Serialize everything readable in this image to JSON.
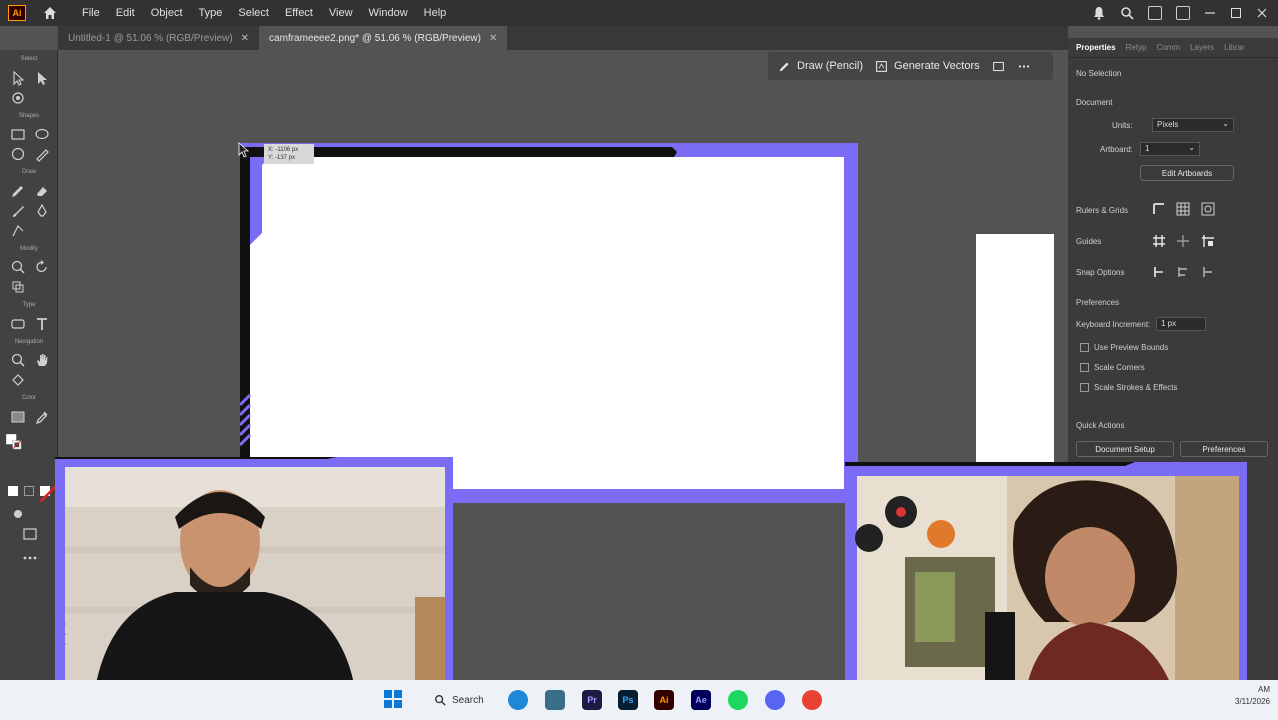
{
  "app": {
    "logo_text": "Ai",
    "menu": [
      "File",
      "Edit",
      "Object",
      "Type",
      "Select",
      "Effect",
      "View",
      "Window",
      "Help"
    ]
  },
  "tabs": [
    {
      "label": "Untitled-1 @ 51.06 % (RGB/Preview)",
      "active": false
    },
    {
      "label": "camframeeee2.png* @ 51.06 % (RGB/Preview)",
      "active": true
    }
  ],
  "toolbar": {
    "sections": [
      "Select",
      "Shapes",
      "Draw",
      "Modify",
      "Type",
      "Navigation",
      "Color"
    ]
  },
  "context_bar": {
    "draw_label": "Draw (Pencil)",
    "vectors_label": "Generate Vectors"
  },
  "canvas": {
    "tooltip_x": "X: -1106 px",
    "tooltip_y": "Y: -137 px",
    "frame_color": "#7b6cf6"
  },
  "panel": {
    "tabs": [
      "Properties",
      "Retyp",
      "Comm",
      "Layers",
      "Librar"
    ],
    "no_selection": "No Selection",
    "document": "Document",
    "units_label": "Units:",
    "units_value": "Pixels",
    "artboard_label": "Artboard:",
    "artboard_value": "1",
    "edit_artboards": "Edit Artboards",
    "rulers_grids": "Rulers & Grids",
    "guides": "Guides",
    "snap_options": "Snap Options",
    "preferences_heading": "Preferences",
    "keyboard_increment_label": "Keyboard Increment:",
    "keyboard_increment_value": "1 px",
    "checkboxes": [
      "Use Preview Bounds",
      "Scale Corners",
      "Scale Strokes & Effects"
    ],
    "quick_actions": "Quick Actions",
    "document_setup": "Document Setup",
    "preferences_button": "Preferences"
  },
  "taskbar": {
    "search": "Search",
    "apps": [
      "Edge",
      "Files",
      "Pr",
      "Ps",
      "Ai",
      "Ae",
      "Spotify",
      "Discord",
      "Chrome"
    ],
    "time": "AM",
    "date": "3/11/2026"
  }
}
